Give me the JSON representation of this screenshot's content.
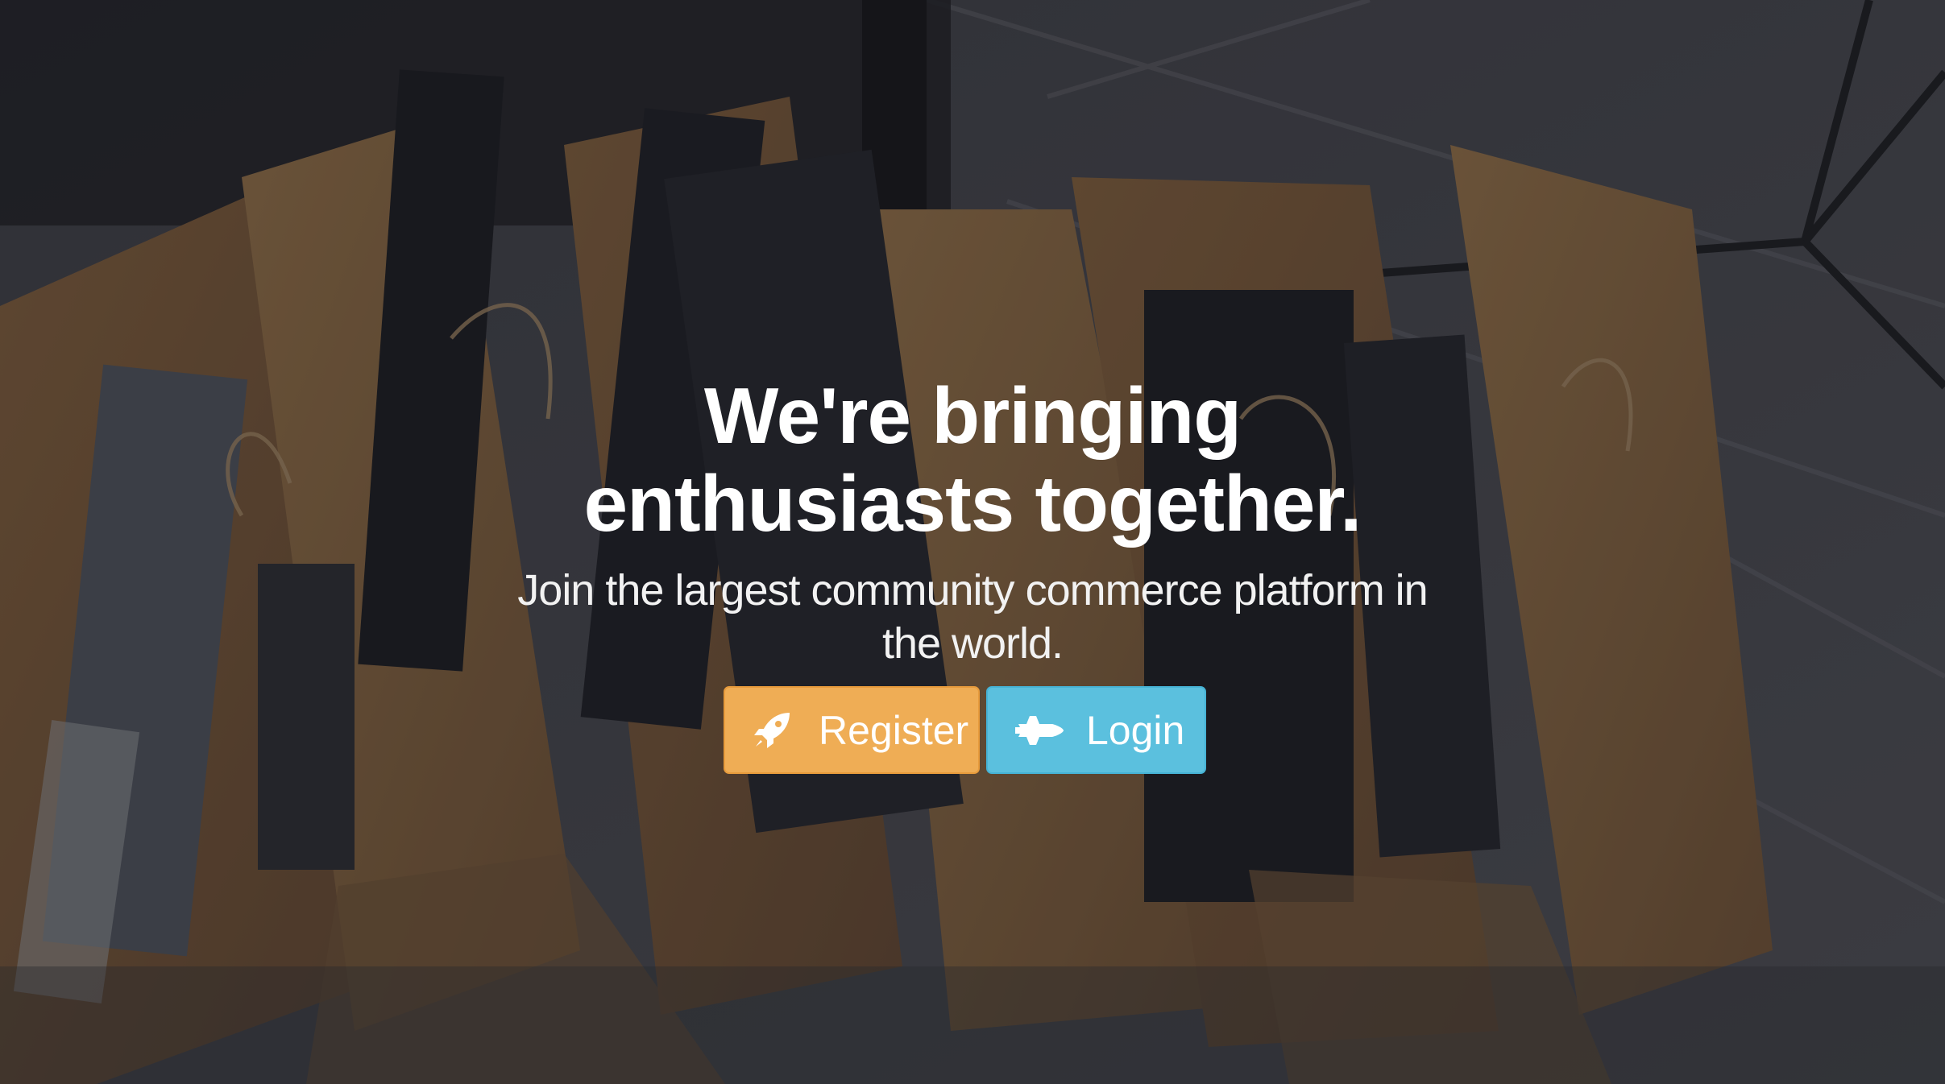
{
  "hero": {
    "headline_line1": "We're bringing",
    "headline_line2": "enthusiasts together.",
    "subline_line1": "Join the largest community commerce platform in",
    "subline_line2": "the world."
  },
  "buttons": {
    "register": {
      "label": "Register",
      "icon": "rocket-icon",
      "color": "#efad55"
    },
    "login": {
      "label": "Login",
      "icon": "space-shuttle-icon",
      "color": "#5bc0de"
    }
  },
  "background": {
    "image": "shopping-bags-photo",
    "overlay_color": "#14141a"
  }
}
